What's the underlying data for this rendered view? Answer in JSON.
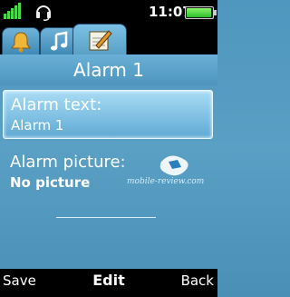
{
  "status": {
    "time": "11:07",
    "battery_level": 0.95,
    "signal_icon": "signal-icon",
    "headset_icon": "headset-icon"
  },
  "tabs": [
    {
      "icon": "bell-icon",
      "active": false
    },
    {
      "icon": "music-note-icon",
      "active": false
    },
    {
      "icon": "notepad-icon",
      "active": true
    }
  ],
  "title": "Alarm 1",
  "fields": {
    "alarm_text": {
      "label": "Alarm text:",
      "value": "Alarm 1"
    },
    "alarm_picture": {
      "label": "Alarm picture:",
      "value": "No picture"
    }
  },
  "watermark": "mobile-review.com",
  "softkeys": {
    "left": "Save",
    "middle": "Edit",
    "right": "Back"
  },
  "colors": {
    "background": "#5a9fc4",
    "selection": "#a9dcf5"
  }
}
